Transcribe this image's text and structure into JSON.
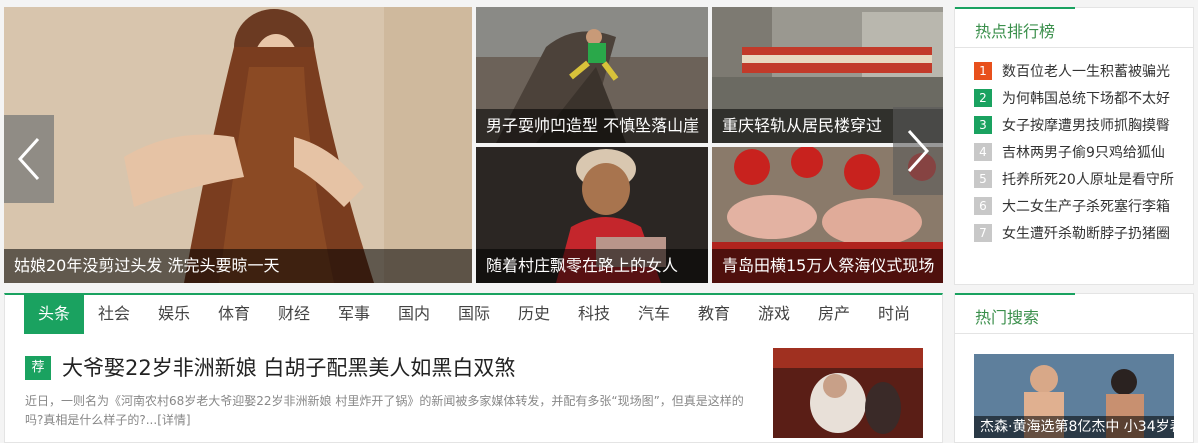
{
  "slider": {
    "main_caption": "姑娘20年没剪过头发 洗完头要晾一天",
    "tiles": [
      {
        "caption": "男子耍帅凹造型 不慎坠落山崖"
      },
      {
        "caption": "重庆轻轨从居民楼穿过"
      },
      {
        "caption": "随着村庄飘零在路上的女人"
      },
      {
        "caption": "青岛田横15万人祭海仪式现场"
      }
    ],
    "prev_icon": "chevron-left-icon",
    "next_icon": "chevron-right-icon"
  },
  "hot_rank": {
    "title": "热点排行榜",
    "items": [
      {
        "num": "1",
        "text": "数百位老人一生积蓄被骗光"
      },
      {
        "num": "2",
        "text": "为何韩国总统下场都不太好"
      },
      {
        "num": "3",
        "text": "女子按摩遭男技师抓胸摸臀"
      },
      {
        "num": "4",
        "text": "吉林两男子偷9只鸡给狐仙"
      },
      {
        "num": "5",
        "text": "托养所死20人原址是看守所"
      },
      {
        "num": "6",
        "text": "大二女生产子杀死塞行李箱"
      },
      {
        "num": "7",
        "text": "女生遭歼杀勒断脖子扔猪圈"
      }
    ],
    "colors": {
      "top": "#e8501c",
      "green": "#1aa260",
      "gray": "#c8c8c8"
    }
  },
  "tabs": [
    "头条",
    "社会",
    "娱乐",
    "体育",
    "财经",
    "军事",
    "国内",
    "国际",
    "历史",
    "科技",
    "汽车",
    "教育",
    "游戏",
    "房产",
    "时尚"
  ],
  "article": {
    "badge": "荐",
    "title": "大爷娶22岁非洲新娘 白胡子配黑美人如黑白双煞",
    "summary_line1": "近日，一则名为《河南农村68岁老大爷迎娶22岁非洲新娘 村里炸开了锅》的新闻被多家媒体转发，并配有多张“现场图”，但真是这样的",
    "summary_line2": "吗?真相是什么样子的?...",
    "detail_link": "[详情]"
  },
  "hot_search": {
    "title": "热门搜索",
    "caption": "杰森·黄海选第8亿杰中 小34岁表"
  }
}
